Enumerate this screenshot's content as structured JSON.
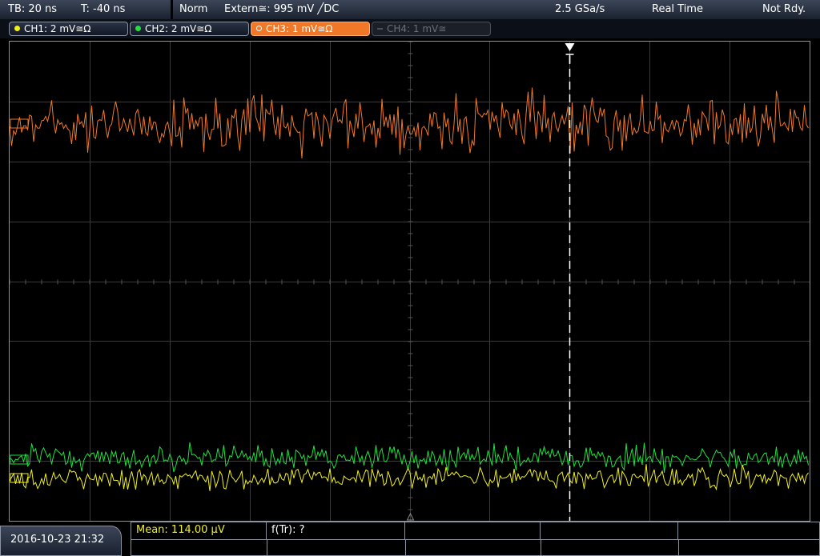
{
  "header": {
    "timebase": "TB: 20 ns",
    "trigger_time": "T: -40 ns",
    "trigger_mode": "Norm",
    "trigger_source": "Extern≅: 995 mV ╱DC",
    "sample_rate": "2.5 GSa/s",
    "acq_mode": "Real Time",
    "status": "Not Rdy."
  },
  "channels": [
    {
      "label": "CH1: 2 mV≅Ω",
      "color": "#f0f020",
      "state": "inactive"
    },
    {
      "label": "CH2: 2 mV≅Ω",
      "color": "#20e040",
      "state": "inactive"
    },
    {
      "label": "CH3: 1 mV≅Ω",
      "color": "#f07828",
      "state": "active"
    },
    {
      "label": "CH4: 1 mV≅",
      "color": "#5a6068",
      "state": "off"
    }
  ],
  "footer": {
    "datetime": "2016-10-23 21:32",
    "mean": "Mean: 114.00 µV",
    "freq": "f(Tr): ?"
  },
  "colors": {
    "ch1": "#f0f020",
    "ch2": "#20e040",
    "ch3": "#f07828",
    "grid": "#3a3a3a",
    "mean_text": "#f0f020"
  }
}
